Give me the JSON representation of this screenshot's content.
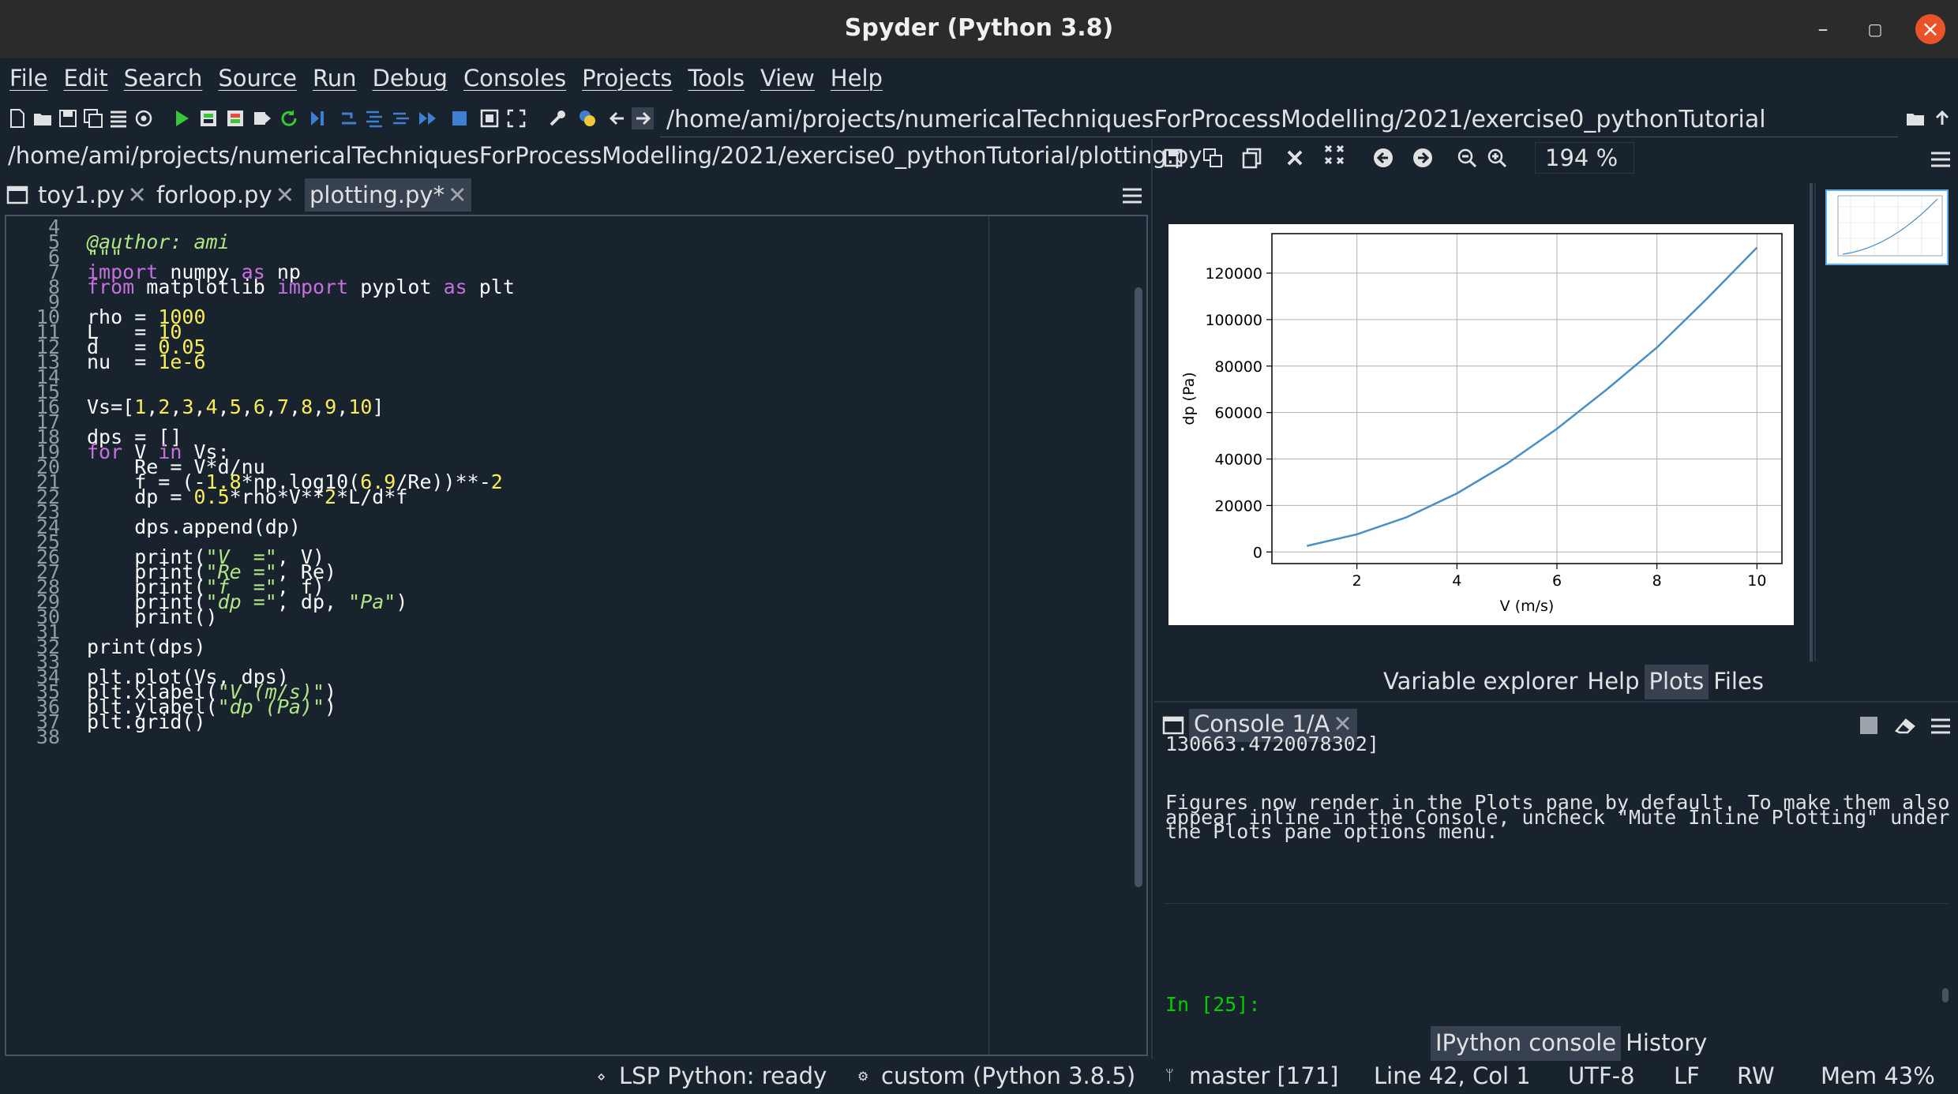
{
  "window": {
    "title": "Spyder (Python 3.8)"
  },
  "menu": [
    "File",
    "Edit",
    "Search",
    "Source",
    "Run",
    "Debug",
    "Consoles",
    "Projects",
    "Tools",
    "View",
    "Help"
  ],
  "toolbar": {
    "working_dir": "/home/ami/projects/numericalTechniquesForProcessModelling/2021/exercise0_pythonTutorial"
  },
  "editor": {
    "path": "/home/ami/projects/numericalTechniquesForProcessModelling/2021/exercise0_pythonTutorial/plotting.py",
    "tabs": [
      {
        "label": "toy1.py",
        "active": false
      },
      {
        "label": "forloop.py",
        "active": false
      },
      {
        "label": "plotting.py*",
        "active": true
      }
    ],
    "lines": [
      {
        "n": "4",
        "t": ""
      },
      {
        "n": "5",
        "t": "@author: ami"
      },
      {
        "n": "6",
        "t": "\"\"\""
      },
      {
        "n": "7",
        "t": "import numpy as np"
      },
      {
        "n": "8",
        "t": "from matplotlib import pyplot as plt"
      },
      {
        "n": "9",
        "t": ""
      },
      {
        "n": "10",
        "t": "rho = 1000"
      },
      {
        "n": "11",
        "t": "L   = 10"
      },
      {
        "n": "12",
        "t": "d   = 0.05"
      },
      {
        "n": "13",
        "t": "nu  = 1e-6"
      },
      {
        "n": "14",
        "t": ""
      },
      {
        "n": "15",
        "t": ""
      },
      {
        "n": "16",
        "t": "Vs=[1,2,3,4,5,6,7,8,9,10]"
      },
      {
        "n": "17",
        "t": ""
      },
      {
        "n": "18",
        "t": "dps = []"
      },
      {
        "n": "19",
        "t": "for V in Vs:"
      },
      {
        "n": "20",
        "t": "    Re = V*d/nu"
      },
      {
        "n": "21",
        "t": "    f = (-1.8*np.log10(6.9/Re))**-2"
      },
      {
        "n": "22",
        "t": "    dp = 0.5*rho*V**2*L/d*f"
      },
      {
        "n": "23",
        "t": ""
      },
      {
        "n": "24",
        "t": "    dps.append(dp)"
      },
      {
        "n": "25",
        "t": ""
      },
      {
        "n": "26",
        "t": "    print(\"V  =\", V)"
      },
      {
        "n": "27",
        "t": "    print(\"Re =\", Re)"
      },
      {
        "n": "28",
        "t": "    print(\"f  =\", f)"
      },
      {
        "n": "29",
        "t": "    print(\"dp =\", dp, \"Pa\")"
      },
      {
        "n": "30",
        "t": "    print()"
      },
      {
        "n": "31",
        "t": ""
      },
      {
        "n": "32",
        "t": "print(dps)"
      },
      {
        "n": "33",
        "t": ""
      },
      {
        "n": "34",
        "t": "plt.plot(Vs, dps)"
      },
      {
        "n": "35",
        "t": "plt.xlabel(\"V (m/s)\")"
      },
      {
        "n": "36",
        "t": "plt.ylabel(\"dp (Pa)\")"
      },
      {
        "n": "37",
        "t": "plt.grid()"
      },
      {
        "n": "38",
        "t": ""
      }
    ]
  },
  "plots": {
    "zoom": "194 %",
    "pane_tabs": [
      "Variable explorer",
      "Help",
      "Plots",
      "Files"
    ],
    "active_pane_tab": "Plots"
  },
  "chart_data": {
    "type": "line",
    "xlabel": "V (m/s)",
    "ylabel": "dp (Pa)",
    "x": [
      1,
      2,
      3,
      4,
      5,
      6,
      7,
      8,
      9,
      10
    ],
    "values": [
      2600,
      7600,
      15000,
      25200,
      38000,
      53000,
      70000,
      88000,
      109000,
      131000
    ],
    "xlim": [
      0.3,
      10.5
    ],
    "ylim": [
      -5000,
      137000
    ],
    "xticks": [
      "2",
      "4",
      "6",
      "8",
      "10"
    ],
    "yticks": [
      "0",
      "20000",
      "40000",
      "60000",
      "80000",
      "100000",
      "120000"
    ],
    "grid": true,
    "line_color": "#4a8fc4"
  },
  "console": {
    "tab_label": "Console 1/A",
    "lines": [
      "130663.4720078302]",
      "",
      "",
      "",
      "Figures now render in the Plots pane by default. To make them also",
      "appear inline in the Console, uncheck \"Mute Inline Plotting\" under",
      "the Plots pane options menu.",
      "",
      "",
      "",
      "",
      ""
    ],
    "prompt": "In [25]:",
    "pane_tabs": [
      "IPython console",
      "History"
    ],
    "active_pane_tab": "IPython console"
  },
  "status": {
    "lsp": "LSP Python: ready",
    "env": "custom (Python 3.8.5)",
    "git": "master [171]",
    "cursor": "Line 42, Col 1",
    "encoding": "UTF-8",
    "eol": "LF",
    "rw": "RW",
    "mem": "Mem 43%"
  }
}
